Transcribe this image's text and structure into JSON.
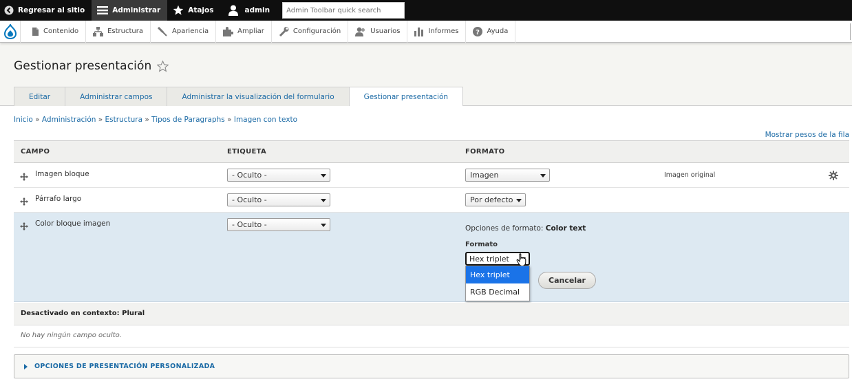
{
  "toolbar": {
    "back_label": "Regresar al sitio",
    "manage_label": "Administrar",
    "shortcuts_label": "Atajos",
    "user_label": "admin",
    "search_placeholder": "Admin Toolbar quick search"
  },
  "admin_menu": {
    "items": [
      {
        "label": "Contenido",
        "icon": "file-icon"
      },
      {
        "label": "Estructura",
        "icon": "structure-icon"
      },
      {
        "label": "Apariencia",
        "icon": "paintbrush-icon"
      },
      {
        "label": "Ampliar",
        "icon": "puzzle-icon"
      },
      {
        "label": "Configuración",
        "icon": "wrench-icon"
      },
      {
        "label": "Usuarios",
        "icon": "users-icon"
      },
      {
        "label": "Informes",
        "icon": "bar-chart-icon"
      },
      {
        "label": "Ayuda",
        "icon": "help-icon"
      }
    ]
  },
  "page": {
    "title": "Gestionar presentación",
    "tabs": [
      {
        "label": "Editar"
      },
      {
        "label": "Administrar campos"
      },
      {
        "label": "Administrar la visualización del formulario"
      },
      {
        "label": "Gestionar presentación"
      }
    ],
    "active_tab": 3,
    "breadcrumb": [
      "Inicio",
      "Administración",
      "Estructura",
      "Tipos de Paragraphs",
      "Imagen con texto"
    ],
    "breadcrumb_sep": "»",
    "row_weights_link": "Mostrar pesos de la fila"
  },
  "table": {
    "headers": {
      "field": "CAMPO",
      "label": "ETIQUETA",
      "format": "FORMATO"
    },
    "rows": [
      {
        "field": "Imagen bloque",
        "label_value": "- Oculto -",
        "format_value": "Imagen",
        "summary": "Imagen original"
      },
      {
        "field": "Párrafo largo",
        "label_value": "- Oculto -",
        "format_value": "Por defecto"
      },
      {
        "field": "Color bloque imagen",
        "label_value": "- Oculto -"
      }
    ],
    "format_settings": {
      "options_prefix": "Opciones de formato:",
      "options_name": "Color text",
      "format_label": "Formato",
      "selected": "Hex triplet",
      "options": [
        "Hex triplet",
        "RGB Decimal"
      ],
      "cancel_label": "Cancelar"
    }
  },
  "disabled": {
    "heading": "Desactivado en contexto: Plural",
    "empty_text": "No hay ningún campo oculto."
  },
  "custom_display": {
    "label": "OPCIONES DE PRESENTACIÓN PERSONALIZADA"
  },
  "colors": {
    "link": "#1b6aa5",
    "highlight_row": "#dde9f2",
    "dropdown_selected": "#1a73e8",
    "drupal_blue": "#0678be"
  }
}
